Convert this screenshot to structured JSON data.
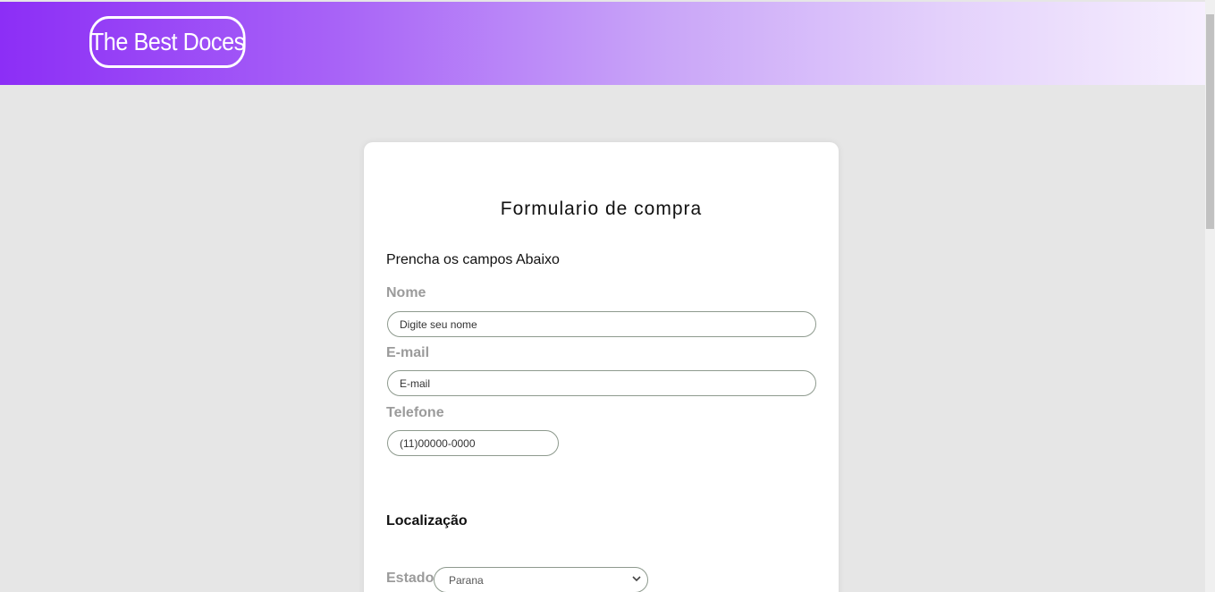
{
  "header": {
    "logo": "The Best Doces",
    "colors": {
      "gradient_start": "#8c2ef6",
      "gradient_end": "#f6effe"
    }
  },
  "form": {
    "title": "Formulario de compra",
    "subtitle": "Prencha os campos Abaixo",
    "nome": {
      "label": "Nome",
      "placeholder": "Digite seu nome"
    },
    "email": {
      "label": "E-mail",
      "placeholder": "E-mail"
    },
    "telefone": {
      "label": "Telefone",
      "placeholder": "(11)00000-0000"
    },
    "section_localizacao": "Localização",
    "estado": {
      "label": "Estado",
      "selected": "Parana"
    }
  }
}
